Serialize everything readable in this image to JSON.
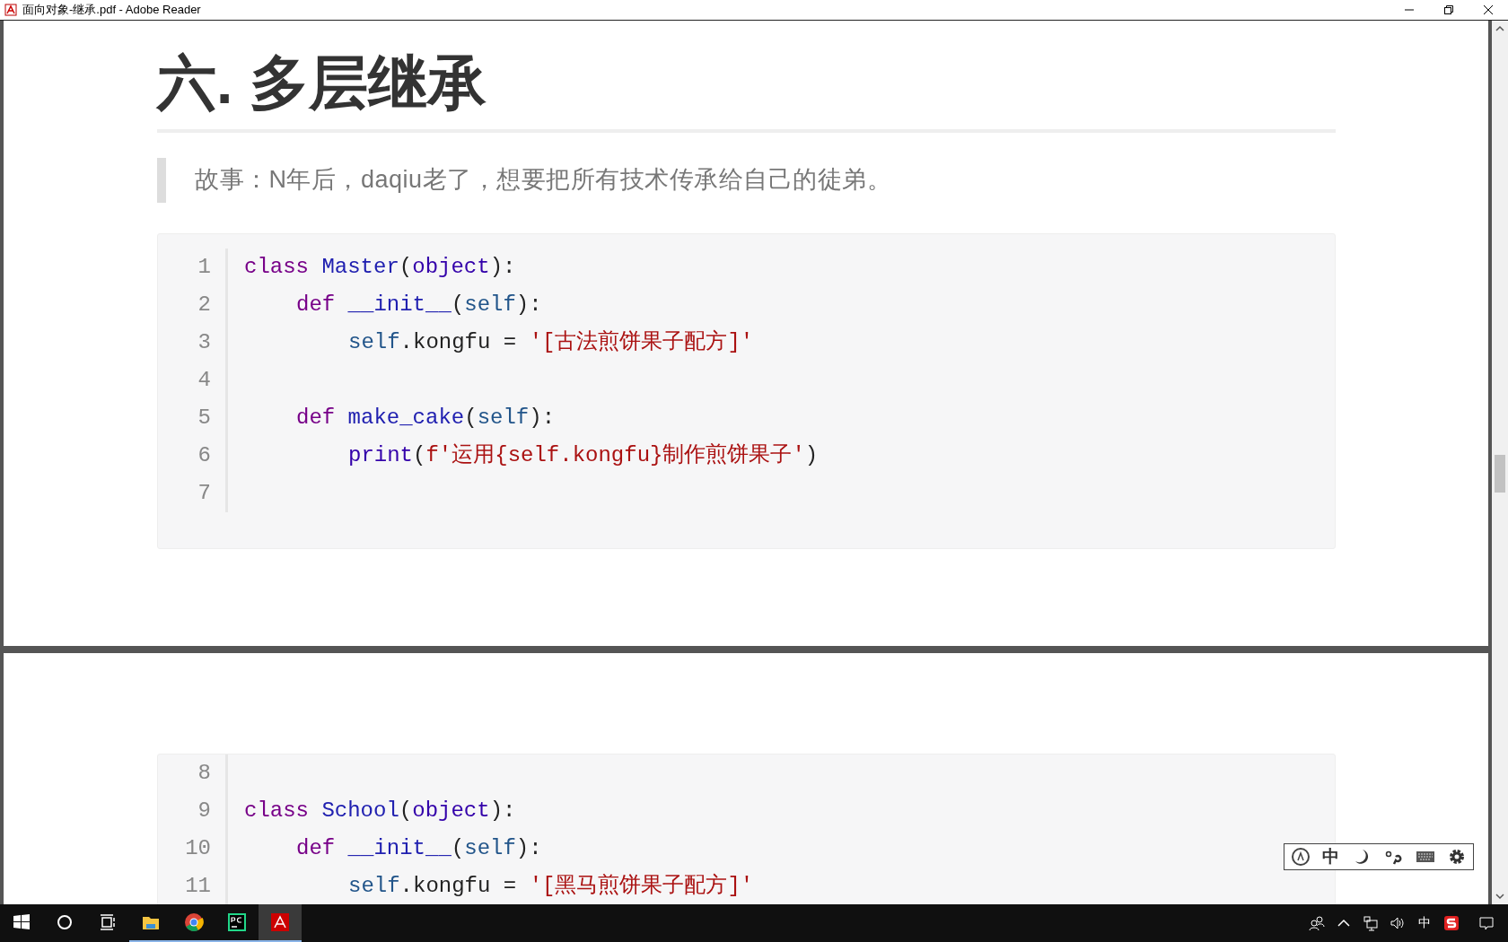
{
  "window": {
    "title": "面向对象-继承.pdf - Adobe Reader"
  },
  "document": {
    "heading": "六. 多层继承",
    "quote": "故事：N年后，daqiu老了，想要把所有技术传承给自己的徒弟。",
    "code_blocks": [
      {
        "lines": [
          {
            "number": "1",
            "tokens": [
              {
                "kind": "keyword",
                "text": "class"
              },
              {
                "kind": "def",
                "text": "Master",
                "space_before": true
              },
              {
                "kind": "plain",
                "text": "("
              },
              {
                "kind": "builtin",
                "text": "object"
              },
              {
                "kind": "plain",
                "text": "):"
              }
            ],
            "children": [
              {
                "number": "2",
                "tokens": [
                  {
                    "kind": "keyword",
                    "text": "def"
                  },
                  {
                    "kind": "def",
                    "text": "__init__",
                    "space_before": true
                  },
                  {
                    "kind": "plain",
                    "text": "("
                  },
                  {
                    "kind": "self",
                    "text": "self"
                  },
                  {
                    "kind": "plain",
                    "text": "):"
                  }
                ],
                "children": [
                  {
                    "number": "3",
                    "tokens": [
                      {
                        "kind": "self",
                        "text": "self"
                      },
                      {
                        "kind": "plain",
                        "text": ".kongfu ="
                      },
                      {
                        "kind": "string",
                        "text": "'[古法煎饼果子配方]'",
                        "space_before": true
                      }
                    ]
                  }
                ]
              },
              {
                "number": "4"
              },
              {
                "number": "5",
                "tokens": [
                  {
                    "kind": "keyword",
                    "text": "def"
                  },
                  {
                    "kind": "def",
                    "text": "make_cake",
                    "space_before": true
                  },
                  {
                    "kind": "plain",
                    "text": "("
                  },
                  {
                    "kind": "self",
                    "text": "self"
                  },
                  {
                    "kind": "plain",
                    "text": "):"
                  }
                ],
                "children": [
                  {
                    "number": "6",
                    "tokens": [
                      {
                        "kind": "builtin",
                        "text": "print"
                      },
                      {
                        "kind": "plain",
                        "text": "("
                      },
                      {
                        "kind": "string",
                        "text": "f'运用{self.kongfu}制作煎饼果子'"
                      },
                      {
                        "kind": "plain",
                        "text": ")"
                      }
                    ]
                  }
                ]
              }
            ]
          },
          {
            "number": "7"
          }
        ]
      },
      {
        "lines": [
          {
            "number": "8"
          },
          {
            "number": "9",
            "tokens": [
              {
                "kind": "keyword",
                "text": "class"
              },
              {
                "kind": "def",
                "text": "School",
                "space_before": true
              },
              {
                "kind": "plain",
                "text": "("
              },
              {
                "kind": "builtin",
                "text": "object"
              },
              {
                "kind": "plain",
                "text": "):"
              }
            ],
            "children": [
              {
                "number": "10",
                "tokens": [
                  {
                    "kind": "keyword",
                    "text": "def"
                  },
                  {
                    "kind": "def",
                    "text": "__init__",
                    "space_before": true
                  },
                  {
                    "kind": "plain",
                    "text": "("
                  },
                  {
                    "kind": "self",
                    "text": "self"
                  },
                  {
                    "kind": "plain",
                    "text": "):"
                  }
                ],
                "children": [
                  {
                    "number": "11",
                    "tokens": [
                      {
                        "kind": "self",
                        "text": "self"
                      },
                      {
                        "kind": "plain",
                        "text": ".kongfu ="
                      },
                      {
                        "kind": "string",
                        "text": "'[黑马煎饼果子配方]'",
                        "space_before": true
                      }
                    ]
                  }
                ]
              }
            ]
          }
        ]
      }
    ]
  },
  "ime_toolbar": {
    "mode_label": "中"
  },
  "taskbar": {
    "apps": [
      {
        "kind": "folder",
        "selected": false
      },
      {
        "kind": "chrome",
        "selected": false
      },
      {
        "kind": "pycharm",
        "selected": false
      },
      {
        "kind": "acrobat",
        "selected": true
      }
    ],
    "tray": {
      "input_label": "中"
    }
  }
}
